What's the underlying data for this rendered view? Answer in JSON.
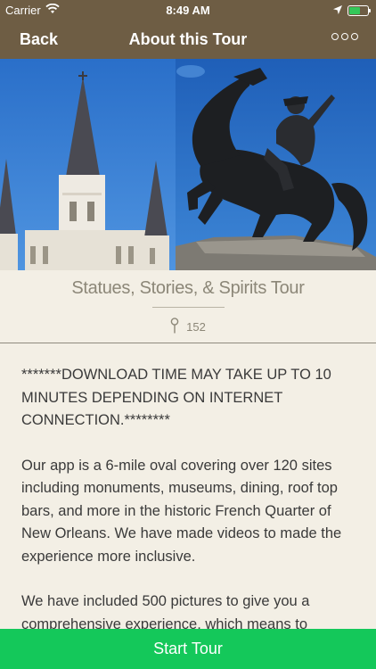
{
  "status_bar": {
    "carrier": "Carrier",
    "time": "8:49 AM"
  },
  "nav": {
    "back_label": "Back",
    "title": "About this Tour"
  },
  "tour": {
    "title": "Statues, Stories, & Spirits Tour",
    "stop_count": "152"
  },
  "description": {
    "paragraphs": [
      "*******DOWNLOAD TIME MAY TAKE UP TO 10 MINUTES DEPENDING ON INTERNET CONNECTION.********",
      "Our app is a 6-mile oval covering over 120 sites including monuments, museums, dining, roof top bars, and more in the historic French Quarter of New Orleans. We have made videos to made the experience more inclusive.",
      "We have included 500 pictures to give you a comprehensive experience, which means to"
    ]
  },
  "footer": {
    "start_label": "Start Tour"
  },
  "colors": {
    "nav_background": "#6e5d44",
    "page_background": "#f3efe5",
    "start_button": "#14c85a",
    "title_text": "#8c8778"
  },
  "icons": {
    "wifi": "wifi-icon",
    "location": "location-arrow-icon",
    "battery": "battery-charging-icon",
    "more": "more-options-icon",
    "pin": "map-pin-icon"
  }
}
